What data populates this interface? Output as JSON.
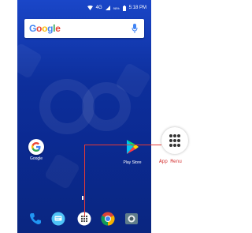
{
  "status_bar": {
    "network": "4G",
    "battery": "98%",
    "time": "5:18 PM"
  },
  "search": {
    "brand": "Google",
    "mic_icon": "microphone-icon"
  },
  "home_apps": [
    {
      "label": "Google",
      "icon": "google-g-icon"
    },
    {
      "label": "Play Store",
      "icon": "play-store-icon"
    }
  ],
  "dock": [
    {
      "icon": "phone-icon"
    },
    {
      "icon": "messages-icon"
    },
    {
      "icon": "app-drawer-icon"
    },
    {
      "icon": "chrome-icon"
    },
    {
      "icon": "camera-icon"
    }
  ],
  "callout": {
    "label": "App Menu",
    "icon": "app-menu-icon"
  },
  "colors": {
    "wallpaper": "#0d2f9c",
    "callout": "#e53935"
  }
}
